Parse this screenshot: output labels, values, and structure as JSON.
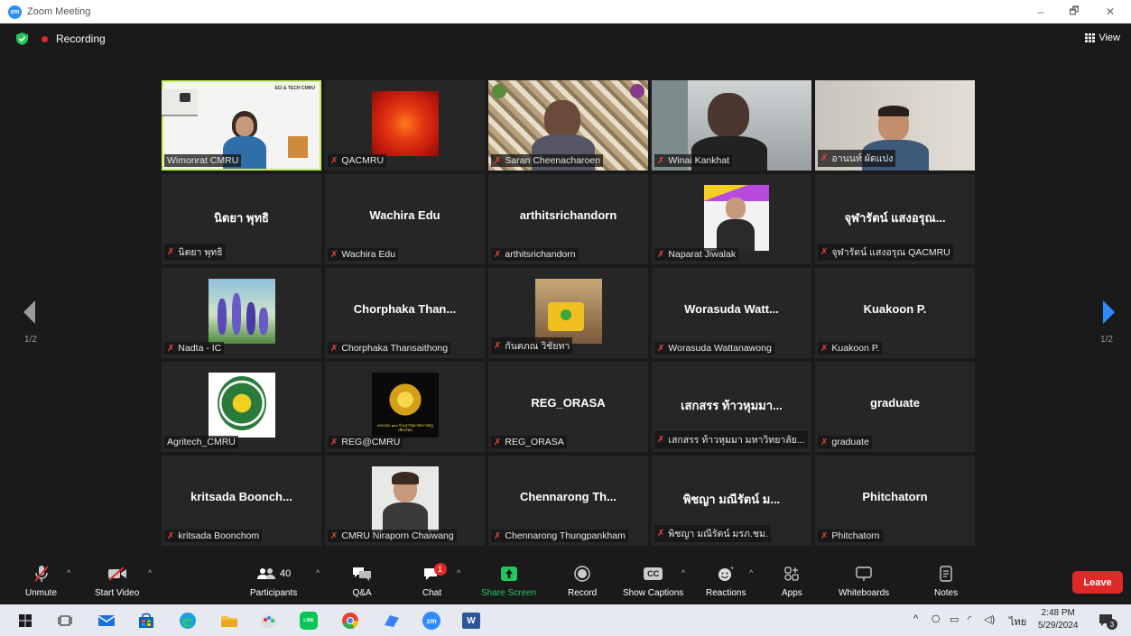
{
  "window": {
    "title": "Zoom Meeting",
    "minimize": "–",
    "restore": "🗗",
    "close": "✕"
  },
  "meeting": {
    "recording_label": "Recording",
    "view_label": "View",
    "page_left": "1/2",
    "page_right": "1/2"
  },
  "tiles": [
    {
      "type": "video",
      "label": "Wimonrat CMRU",
      "muted": false,
      "active": true,
      "banner": "SCI & TECH CMRU"
    },
    {
      "type": "image",
      "label": "QACMRU",
      "muted": true
    },
    {
      "type": "video",
      "label": "Saran Cheenacharoen",
      "muted": true
    },
    {
      "type": "video",
      "label": "Winai Kankhat",
      "muted": true
    },
    {
      "type": "video",
      "label": "อานนท์ ผัดแปง",
      "muted": true
    },
    {
      "type": "name",
      "name": "นิตยา พุทธิ",
      "label": "นิตยา พุทธิ",
      "muted": true
    },
    {
      "type": "name",
      "name": "Wachira Edu",
      "label": "Wachira Edu",
      "muted": true
    },
    {
      "type": "name",
      "name": "arthitsrichandorn",
      "label": "arthitsrichandorn",
      "muted": true
    },
    {
      "type": "image",
      "label": "Naparat Jiwalak",
      "muted": true
    },
    {
      "type": "name",
      "name": "จุฬารัตน์ แสงอรุณ...",
      "label": "จุฬารัตน์ แสงอรุณ QACMRU",
      "muted": true
    },
    {
      "type": "image",
      "label": "Nadta - IC",
      "muted": true
    },
    {
      "type": "name",
      "name": "Chorphaka  Than...",
      "label": "Chorphaka Thansaithong",
      "muted": true
    },
    {
      "type": "image",
      "label": "กันตภณ วิชัยทา",
      "muted": true
    },
    {
      "type": "name",
      "name": "Worasuda  Watt...",
      "label": "Worasuda Wattanawong",
      "muted": true
    },
    {
      "type": "name",
      "name": "Kuakoon P.",
      "label": "Kuakoon P.",
      "muted": true
    },
    {
      "type": "image",
      "label": "Agritech_CMRU",
      "muted": false
    },
    {
      "type": "image",
      "label": "REG@CMRU",
      "muted": true,
      "caption": "ครบรอบ ๑๐๐ ปี มหาวิทยาลัยราชภัฏเชียงใหม่"
    },
    {
      "type": "name",
      "name": "REG_ORASA",
      "label": "REG_ORASA",
      "muted": true
    },
    {
      "type": "name",
      "name": "เสกสรร ท้าวหุมมา...",
      "label": "เสกสรร ท้าวหุมมา มหาวิทยาลัย...",
      "muted": true
    },
    {
      "type": "name",
      "name": "graduate",
      "label": "graduate",
      "muted": true
    },
    {
      "type": "name",
      "name": "kritsada  Boonch...",
      "label": "kritsada Boonchom",
      "muted": true
    },
    {
      "type": "image",
      "label": "CMRU Niraporn Chaiwang",
      "muted": true
    },
    {
      "type": "name",
      "name": "Chennarong  Th...",
      "label": "Chennarong Thungpankham",
      "muted": true
    },
    {
      "type": "name",
      "name": "พิชญา มณีรัตน์ ม...",
      "label": "พิชญา มณีรัตน์ มรภ.ชม.",
      "muted": true
    },
    {
      "type": "name",
      "name": "Phitchatorn",
      "label": "Phitchatorn",
      "muted": true
    }
  ],
  "toolbar": {
    "unmute": "Unmute",
    "start_video": "Start Video",
    "participants": "Participants",
    "participants_count": "40",
    "qa": "Q&A",
    "chat": "Chat",
    "chat_badge": "1",
    "share_screen": "Share Screen",
    "record": "Record",
    "show_captions": "Show Captions",
    "captions_icon": "CC",
    "reactions": "Reactions",
    "apps": "Apps",
    "whiteboards": "Whiteboards",
    "notes": "Notes",
    "leave": "Leave",
    "accent_green": "#22c55e",
    "leave_color": "#e02828"
  },
  "taskbar": {
    "zoom_icon_text": "zm",
    "word_icon_text": "W",
    "line_icon_text": "LINE",
    "language": "ไทย",
    "time": "2:48 PM",
    "date": "5/29/2024",
    "notification_count": "3"
  }
}
